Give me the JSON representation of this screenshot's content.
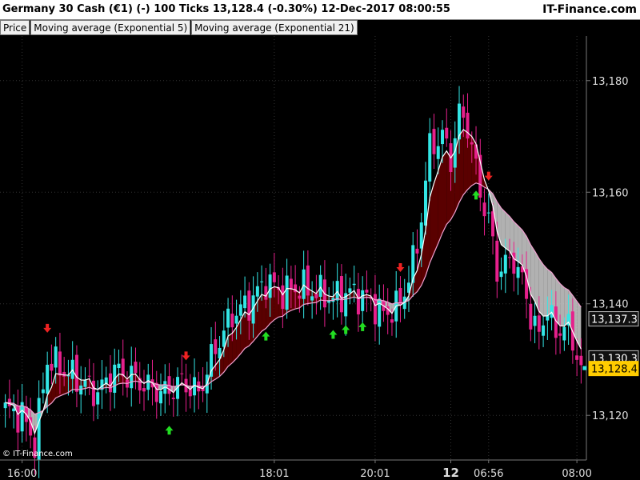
{
  "header": {
    "title": "Germany 30 Cash (€1) (-)   100 Ticks   13,128.4 (-0.30%)   12-Dec-2017 08:00:55",
    "brand": "IT-Finance.com"
  },
  "indicators": [
    "Price",
    "Moving average (Exponential 5)",
    "Moving average (Exponential 21)"
  ],
  "copyright": "© IT-Finance.com",
  "colors": {
    "up": "#33e6e6",
    "down": "#e6208c",
    "buy": "#22dd22",
    "sell": "#ee2222",
    "ema_fast": "#ffffff",
    "ema_slow": "#f0a0d0",
    "fill_bull": "#5a0000",
    "fill_bear": "#d0d0d0"
  },
  "chart_data": {
    "type": "candlestick",
    "ylim": [
      13112,
      13188
    ],
    "y_ticks": [
      13120,
      13140,
      13160,
      13180
    ],
    "y_tick_labels": [
      "13,120",
      "13,140",
      "13,160",
      "13,180"
    ],
    "x_labels": [
      {
        "label": "16:00",
        "bar": 4
      },
      {
        "label": "18:01",
        "bar": 64
      },
      {
        "label": "20:01",
        "bar": 88
      },
      {
        "label": "12",
        "bar": 106,
        "bold": true
      },
      {
        "label": "06:56",
        "bar": 115
      },
      {
        "label": "08:00",
        "bar": 136
      }
    ],
    "price_badges": [
      {
        "value": 13137.3,
        "label": "13,137.3",
        "style": "dark"
      },
      {
        "value": 13130.3,
        "label": "13,130.3",
        "style": "dark"
      },
      {
        "value": 13128.4,
        "label": "13,128.4",
        "style": "current"
      }
    ],
    "anchors": [
      [
        0,
        13121
      ],
      [
        4,
        13120
      ],
      [
        7,
        13115
      ],
      [
        10,
        13130
      ],
      [
        14,
        13128
      ],
      [
        18,
        13126
      ],
      [
        22,
        13124
      ],
      [
        26,
        13128
      ],
      [
        30,
        13127
      ],
      [
        34,
        13125
      ],
      [
        38,
        13124
      ],
      [
        42,
        13126
      ],
      [
        46,
        13124
      ],
      [
        50,
        13132
      ],
      [
        54,
        13138
      ],
      [
        58,
        13140
      ],
      [
        62,
        13144
      ],
      [
        66,
        13142
      ],
      [
        70,
        13143
      ],
      [
        74,
        13142
      ],
      [
        78,
        13141
      ],
      [
        82,
        13142
      ],
      [
        86,
        13141
      ],
      [
        90,
        13138
      ],
      [
        94,
        13140
      ],
      [
        98,
        13150
      ],
      [
        101,
        13168
      ],
      [
        104,
        13170
      ],
      [
        106,
        13166
      ],
      [
        108,
        13174
      ],
      [
        110,
        13172
      ],
      [
        113,
        13160
      ],
      [
        115,
        13155
      ],
      [
        117,
        13146
      ],
      [
        121,
        13148
      ],
      [
        123,
        13144
      ],
      [
        125,
        13138
      ],
      [
        127,
        13134
      ],
      [
        129,
        13140
      ],
      [
        131,
        13134
      ],
      [
        133,
        13137
      ],
      [
        137,
        13129
      ]
    ],
    "ohlc_style": "derived-from-anchors",
    "signals": [
      {
        "bar": 10,
        "dir": "down"
      },
      {
        "bar": 39,
        "dir": "up"
      },
      {
        "bar": 43,
        "dir": "down"
      },
      {
        "bar": 62,
        "dir": "up"
      },
      {
        "bar": 78,
        "dir": "up"
      },
      {
        "bar": 81,
        "dir": "up"
      },
      {
        "bar": 85,
        "dir": "up"
      },
      {
        "bar": 94,
        "dir": "down"
      },
      {
        "bar": 112,
        "dir": "up"
      },
      {
        "bar": 115,
        "dir": "down"
      }
    ],
    "ema_periods": [
      5,
      21
    ]
  }
}
